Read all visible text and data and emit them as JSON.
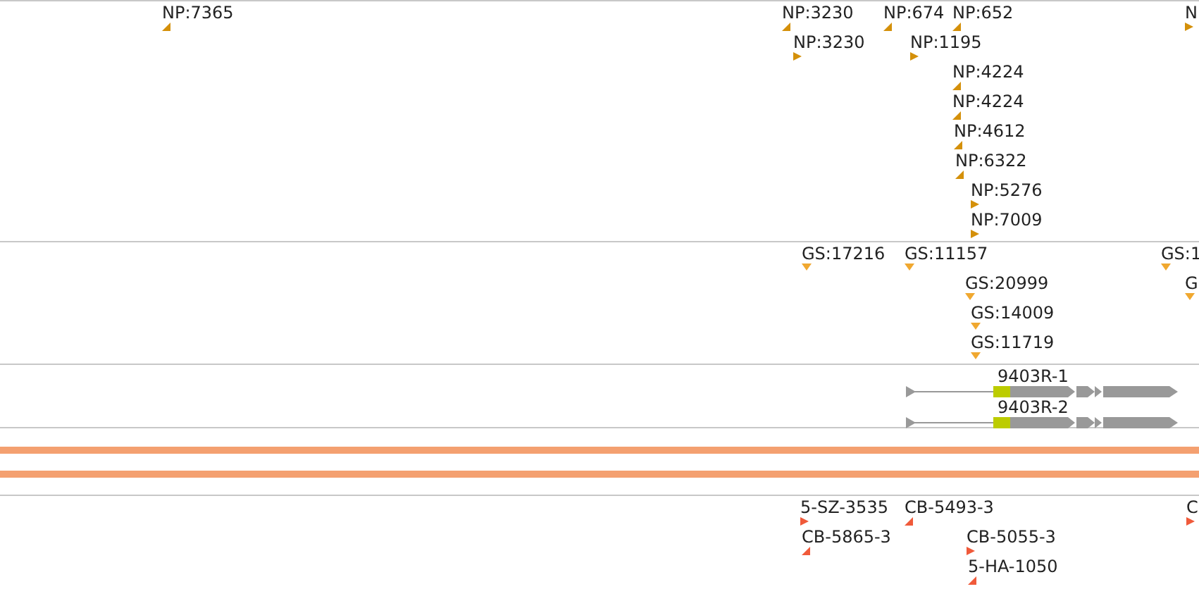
{
  "tracks": [
    {
      "kind": "features",
      "color": "#d4900a",
      "features": [
        {
          "label": "NP:7365",
          "kind": "left"
        },
        {
          "label": "NP:3230",
          "kind": "left"
        },
        {
          "label": "NP:674",
          "kind": "left"
        },
        {
          "label": "NP:652",
          "kind": "left"
        },
        {
          "label": "N",
          "kind": "right"
        },
        {
          "label": "NP:3230",
          "kind": "right"
        },
        {
          "label": "NP:1195",
          "kind": "right"
        },
        {
          "label": "NP:4224",
          "kind": "left"
        },
        {
          "label": "NP:4224",
          "kind": "left"
        },
        {
          "label": "NP:4612",
          "kind": "left"
        },
        {
          "label": "NP:6322",
          "kind": "left"
        },
        {
          "label": "NP:5276",
          "kind": "right"
        },
        {
          "label": "NP:7009",
          "kind": "right"
        }
      ]
    },
    {
      "kind": "features",
      "color": "#f0a830",
      "features": [
        {
          "label": "GS:17216",
          "kind": "down"
        },
        {
          "label": "GS:11157",
          "kind": "down"
        },
        {
          "label": "GS:1",
          "kind": "down"
        },
        {
          "label": "GS:20999",
          "kind": "down"
        },
        {
          "label": "G",
          "kind": "down"
        },
        {
          "label": "GS:14009",
          "kind": "down"
        },
        {
          "label": "GS:11719",
          "kind": "down"
        }
      ]
    },
    {
      "kind": "genes",
      "features": [
        {
          "label": "9403R-1"
        },
        {
          "label": "9403R-2"
        }
      ]
    },
    {
      "kind": "sequence",
      "color": "#f4a070"
    },
    {
      "kind": "features",
      "color": "#f05a3a",
      "features": [
        {
          "label": "5-SZ-3535",
          "kind": "right"
        },
        {
          "label": "CB-5493-3",
          "kind": "left"
        },
        {
          "label": "C",
          "kind": "right"
        },
        {
          "label": "CB-5865-3",
          "kind": "left"
        },
        {
          "label": "CB-5055-3",
          "kind": "right"
        },
        {
          "label": "5-HA-1050",
          "kind": "left"
        }
      ]
    }
  ]
}
